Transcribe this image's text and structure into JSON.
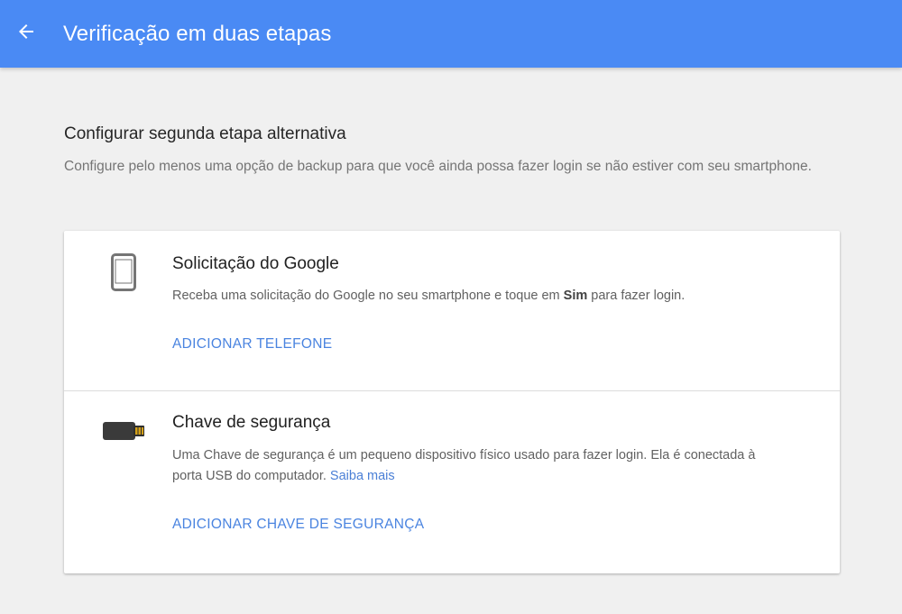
{
  "appbar": {
    "title": "Verificação em duas etapas",
    "back_icon": "arrow-back-icon",
    "color": "#4a8af4"
  },
  "section": {
    "title": "Configurar segunda etapa alternativa",
    "description": "Configure pelo menos uma opção de backup para que você ainda possa fazer login se não estiver com seu smartphone."
  },
  "options": [
    {
      "icon": "smartphone-icon",
      "title": "Solicitação do Google",
      "description_before": "Receba uma solicitação do Google no seu smartphone e toque em ",
      "description_bold": "Sim",
      "description_after": " para fazer login.",
      "action": "ADICIONAR TELEFONE"
    },
    {
      "icon": "usb-security-key-icon",
      "title": "Chave de segurança",
      "description": "Uma Chave de segurança é um pequeno dispositivo físico usado para fazer login. Ela é conectada à porta USB do computador.",
      "link": "Saiba mais",
      "action": "ADICIONAR CHAVE DE SEGURANÇA"
    }
  ],
  "colors": {
    "accent": "#4a84e0",
    "link": "#4a7fd6",
    "background": "#f0f0f0"
  }
}
